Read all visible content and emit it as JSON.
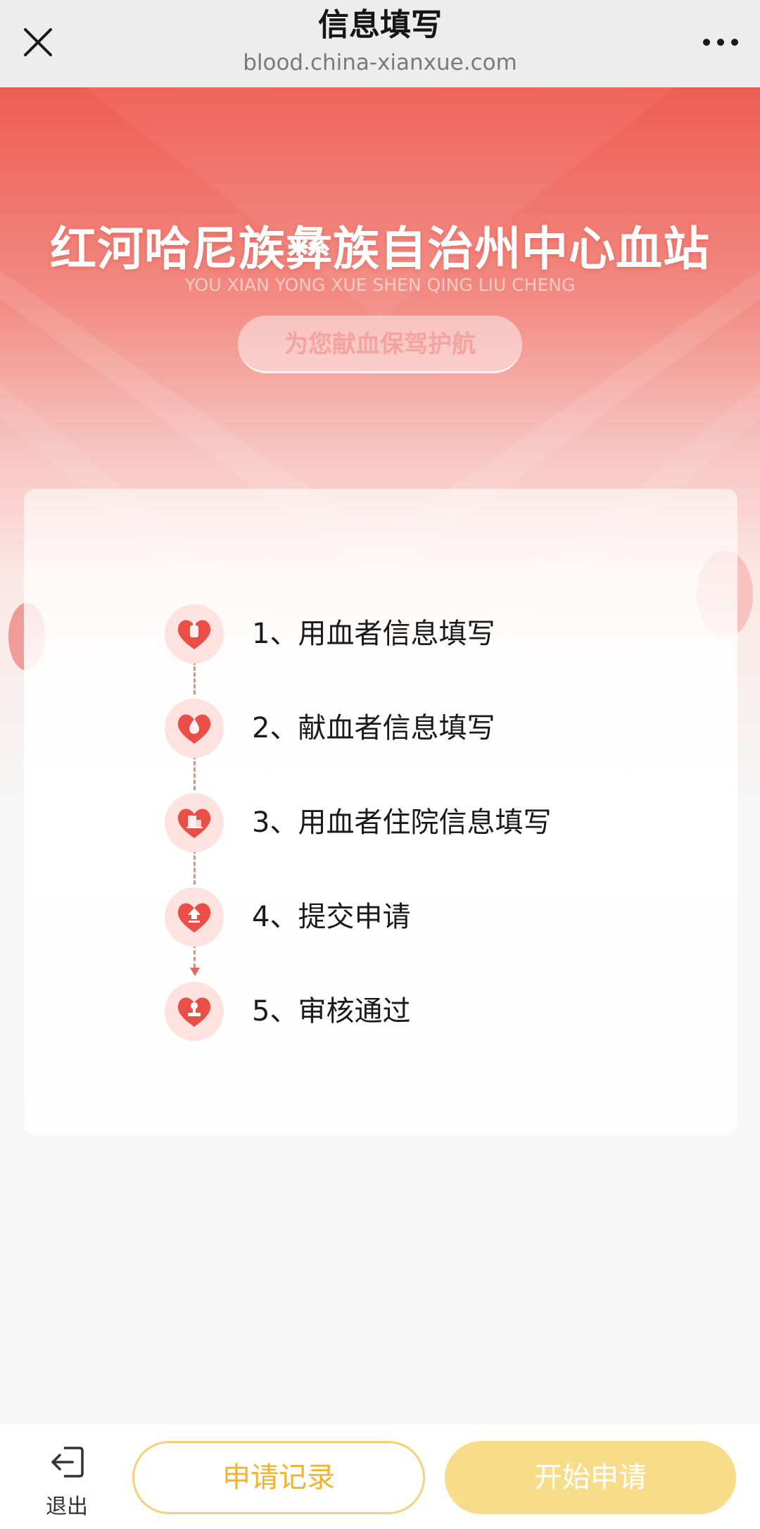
{
  "navbar": {
    "title": "信息填写",
    "url": "blood.china-xianxue.com",
    "close_icon": "close-icon",
    "more_icon": "more-icon"
  },
  "hero": {
    "title": "红河哈尼族彝族自治州中心血站",
    "subtitle": "YOU XIAN YONG XUE SHEN QING LIU CHENG",
    "tagline": "为您献血保驾护航"
  },
  "steps": [
    {
      "label": "1、用血者信息填写",
      "icon": "blood-bag-heart-icon"
    },
    {
      "label": "2、献血者信息填写",
      "icon": "blood-drop-heart-icon"
    },
    {
      "label": "3、用血者住院信息填写",
      "icon": "hospital-heart-icon"
    },
    {
      "label": "4、提交申请",
      "icon": "upload-heart-icon"
    },
    {
      "label": "5、审核通过",
      "icon": "stamp-heart-icon"
    }
  ],
  "bottom_bar": {
    "exit_label": "退出",
    "records_label": "申请记录",
    "start_label": "开始申请"
  },
  "colors": {
    "accent_red": "#ef5d52",
    "heart_red": "#e94f47",
    "button_gold": "#f1b22e",
    "button_gold_fill": "#f7dc8a"
  }
}
